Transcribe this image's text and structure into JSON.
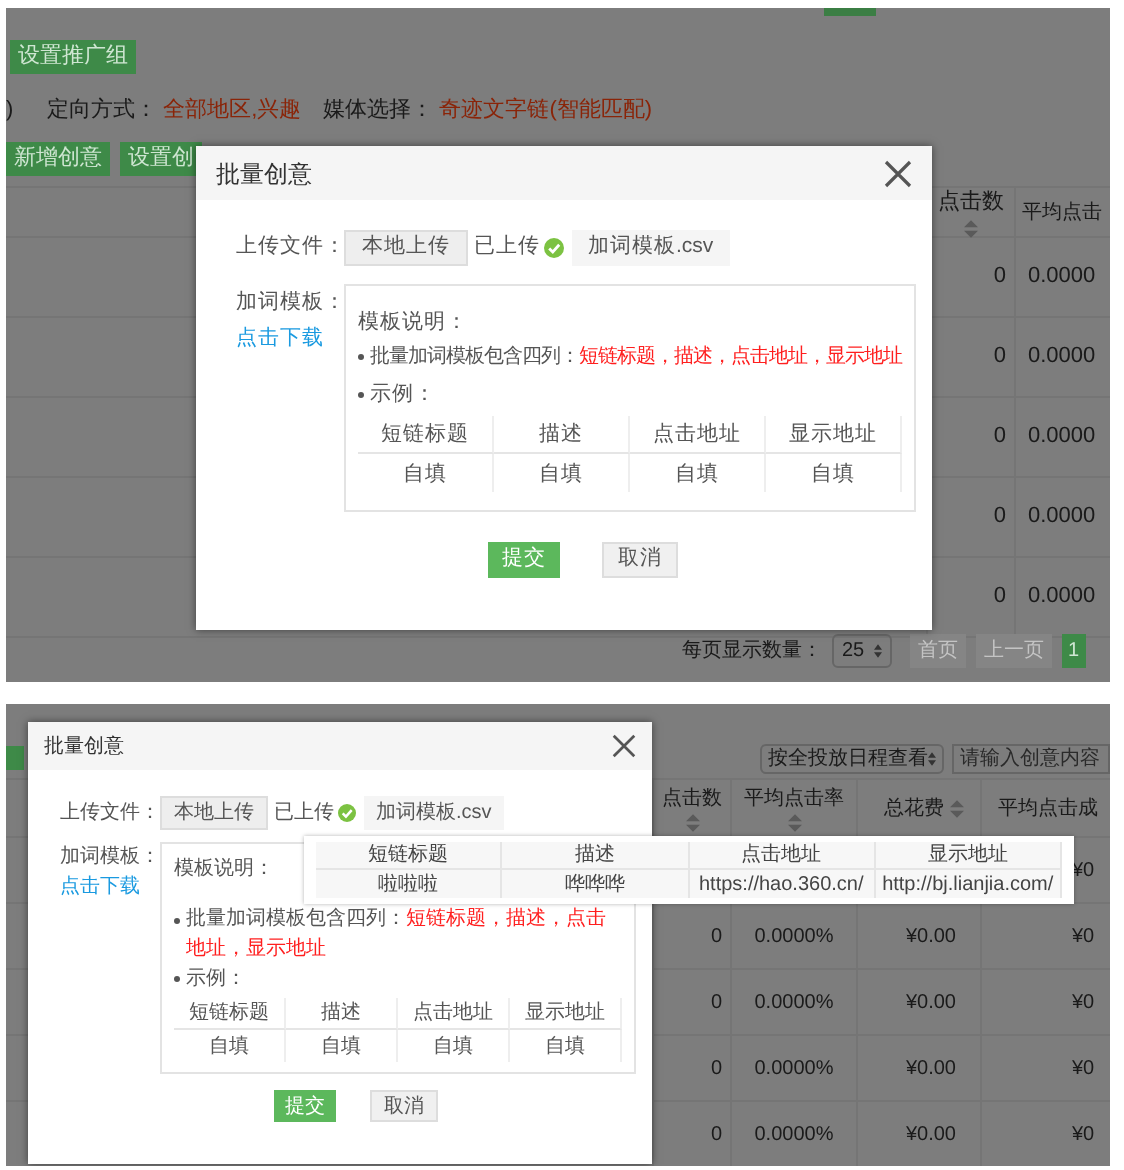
{
  "screens": [
    {
      "kind": "upload-before",
      "page": {
        "group_button": "设置推广组",
        "filter_tail": ")",
        "targeting_label": "定向方式：",
        "targeting_value": "全部地区,兴趣",
        "media_label": "媒体选择：",
        "media_value": "奇迹文字链(智能匹配)",
        "buttons": [
          "新增创意",
          "设置创"
        ],
        "columns": [
          "点击数",
          "平均点击"
        ],
        "rows": [
          {
            "clicks": "0",
            "ctr": "0.0000"
          },
          {
            "clicks": "0",
            "ctr": "0.0000"
          },
          {
            "clicks": "0",
            "ctr": "0.0000"
          },
          {
            "clicks": "0",
            "ctr": "0.0000"
          },
          {
            "clicks": "0",
            "ctr": "0.0000"
          }
        ],
        "pager": {
          "label": "每页显示数量：",
          "page_size": "25",
          "first": "首页",
          "prev": "上一页",
          "current": "1"
        }
      },
      "dialog": {
        "title": "批量创意",
        "upload_label": "上传文件：",
        "upload_button": "本地上传",
        "upload_status": "已上传",
        "uploaded": true,
        "file_name": "加词模板.csv",
        "template_label": "加词模板：",
        "download_link": "点击下载",
        "notes_title": "模板说明：",
        "bullet_1": "批量加词模板包含四列：",
        "bullet_1_value": "短链标题，描述，点击地址，显示地址",
        "bullet_2": "示例：",
        "example_columns": [
          "短链标题",
          "描述",
          "点击地址",
          "显示地址"
        ],
        "example_row": [
          "自填",
          "自填",
          "自填",
          "自填"
        ],
        "submit": "提交",
        "cancel": "取消"
      }
    },
    {
      "kind": "upload-hover",
      "page": {
        "view_select": "按全投放日程查看",
        "search": {
          "placeholder": "请输入创意内容"
        },
        "columns": [
          "点击数",
          "平均点击率",
          "总花费",
          "平均点击成"
        ],
        "rows": [
          {
            "cpc": "¥0"
          },
          {
            "clicks": "0",
            "ctr": "0.0000%",
            "cost": "¥0.00",
            "cpc": "¥0"
          },
          {
            "clicks": "0",
            "ctr": "0.0000%",
            "cost": "¥0.00",
            "cpc": "¥0"
          },
          {
            "clicks": "0",
            "ctr": "0.0000%",
            "cost": "¥0.00",
            "cpc": "¥0"
          },
          {
            "clicks": "0",
            "ctr": "0.0000%",
            "cost": "¥0.00",
            "cpc": "¥0"
          }
        ]
      },
      "dialog": {
        "title": "批量创意",
        "upload_label": "上传文件：",
        "upload_button": "本地上传",
        "upload_status": "已上传",
        "uploaded": true,
        "file_name": "加词模板.csv",
        "template_label": "加词模板：",
        "download_link": "点击下载",
        "notes_title": "模板说明：",
        "bullet_1": "批量加词模板包含四列：",
        "bullet_1_value": "短链标题，描述，点击地址，显示地址",
        "bullet_2": "示例：",
        "example_columns": [
          "短链标题",
          "描述",
          "点击地址",
          "显示地址"
        ],
        "example_row": [
          "自填",
          "自填",
          "自填",
          "自填"
        ],
        "submit": "提交",
        "cancel": "取消"
      },
      "tooltip": {
        "columns": [
          "短链标题",
          "描述",
          "点击地址",
          "显示地址"
        ],
        "row": [
          "啦啦啦",
          "哗哗哗",
          "https://hao.360.cn/",
          "http://bj.lianjia.com/"
        ]
      }
    }
  ]
}
